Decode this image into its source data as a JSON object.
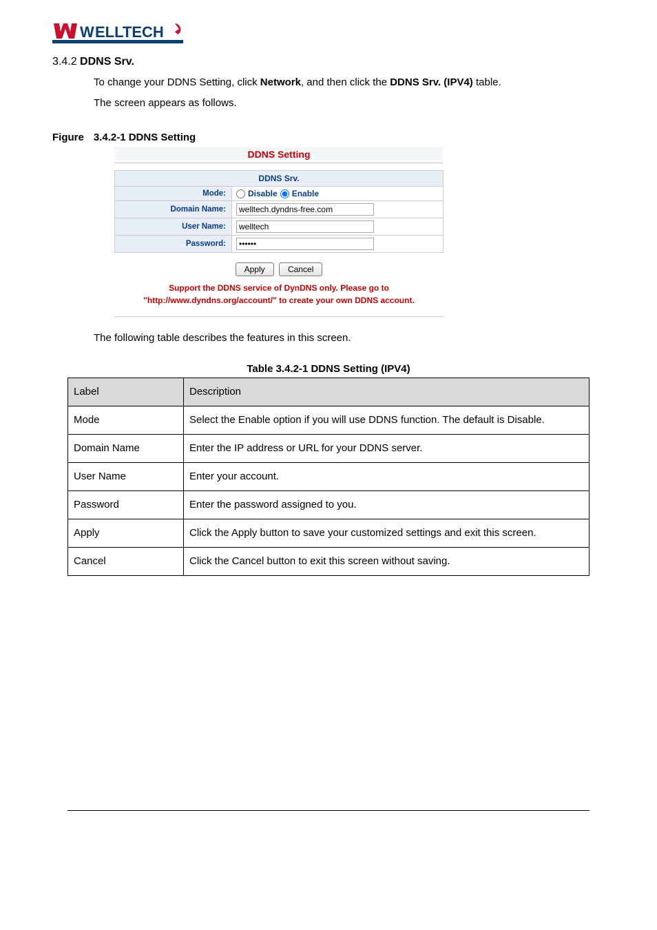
{
  "logo": {
    "brand_left": "W",
    "brand_right": "ELLTECH"
  },
  "section": {
    "number": "3.4.2",
    "title": "DDNS Srv."
  },
  "intro": {
    "p1_a": "To change your DDNS Setting, click ",
    "p1_b": "Network",
    "p1_c": ", and then click the ",
    "p1_d": "DDNS Srv. (IPV4)",
    "p1_e": " table.",
    "p2": "The screen appears as follows."
  },
  "figure_caption": {
    "prefix": "Figure",
    "rest": "3.4.2-1 DDNS Setting"
  },
  "ddns": {
    "heading": "DDNS Setting",
    "srv_header": "DDNS Srv.",
    "rows": {
      "mode_label": "Mode:",
      "mode_disable": "Disable",
      "mode_enable": "Enable",
      "domain_label": "Domain Name:",
      "domain_value": "welltech.dyndns-free.com",
      "user_label": "User Name:",
      "user_value": "welltech",
      "pass_label": "Password:",
      "pass_value": "••••••"
    },
    "buttons": {
      "apply": "Apply",
      "cancel": "Cancel"
    },
    "support": "Support the DDNS service of DynDNS only. Please go to \"http://www.dyndns.org/account/\" to create your own DDNS account."
  },
  "desc_line": "The following table describes the features in this screen.",
  "table_caption": "Table 3.4.2-1 DDNS Setting (IPV4)",
  "table": {
    "header": {
      "label": "Label",
      "desc": "Description"
    },
    "rows": [
      {
        "label": "Mode",
        "desc": "Select the Enable option if you will use DDNS function. The default is Disable."
      },
      {
        "label": "Domain Name",
        "desc": "Enter the IP address or URL for your DDNS server."
      },
      {
        "label": "User Name",
        "desc": "Enter your account."
      },
      {
        "label": "Password",
        "desc": "Enter the password assigned to you."
      },
      {
        "label": "Apply",
        "desc": "Click the Apply button to save your customized settings and exit this screen."
      },
      {
        "label": "Cancel",
        "desc": "Click the Cancel button to exit this screen without saving."
      }
    ]
  }
}
